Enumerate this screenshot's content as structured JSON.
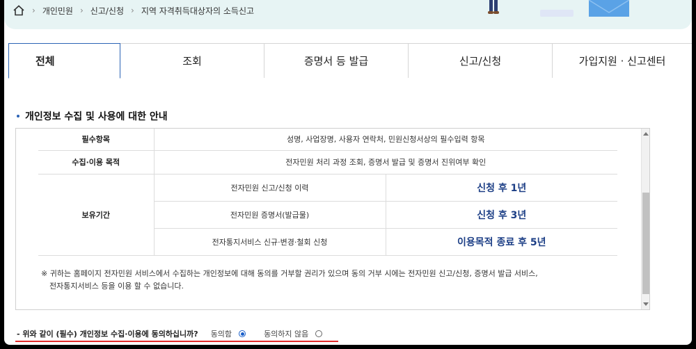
{
  "breadcrumb": {
    "home_icon": "home-icon",
    "items": [
      "개인민원",
      "신고/신청",
      "지역 자격취득대상자의 소득신고"
    ]
  },
  "tabs": [
    {
      "label": "전체",
      "active": true
    },
    {
      "label": "조회",
      "active": false
    },
    {
      "label": "증명서 등 발급",
      "active": false
    },
    {
      "label": "신고/신청",
      "active": false
    },
    {
      "label": "가입지원 · 신고센터",
      "active": false
    }
  ],
  "section": {
    "title": "개인정보 수집 및 사용에 대한 안내"
  },
  "info_table": {
    "required_items": {
      "label": "필수항목",
      "value": "성명, 사업장명, 사용자 연락처, 민원신청서상의 필수입력 항목"
    },
    "purpose": {
      "label": "수집·이용 목적",
      "value": "전자민원 처리 과정 조회, 증명서 발급 및 증명서 진위여부 확인"
    },
    "retention": {
      "label": "보유기간",
      "rows": [
        {
          "item": "전자민원 신고/신청 이력",
          "period": "신청 후 1년"
        },
        {
          "item": "전자민원 증명서(발급물)",
          "period": "신청 후 3년"
        },
        {
          "item": "전자통지서비스 신규·변경·철회 신청",
          "period": "이용목적 종료 후 5년"
        }
      ]
    }
  },
  "note": {
    "line1": "※ 귀하는 홈페이지 전자민원 서비스에서 수집하는 개인정보에 대해 동의를 거부할 권리가 있으며 동의 거부 시에는 전자민원 신고/신청, 증명서 발급 서비스,",
    "line2": "전자통지서비스 등을 이용 할 수 없습니다."
  },
  "consent": {
    "question": "- 위와 같이 (필수) 개인정보 수집·이용에 동의하십니까?",
    "agree_label": "동의함",
    "disagree_label": "동의하지 않음",
    "selected": "agree"
  },
  "colors": {
    "accent": "#2b63b5",
    "highlight_text": "#1d3f86",
    "underline": "#e32b2b",
    "top_band": "#e7f4f4"
  }
}
